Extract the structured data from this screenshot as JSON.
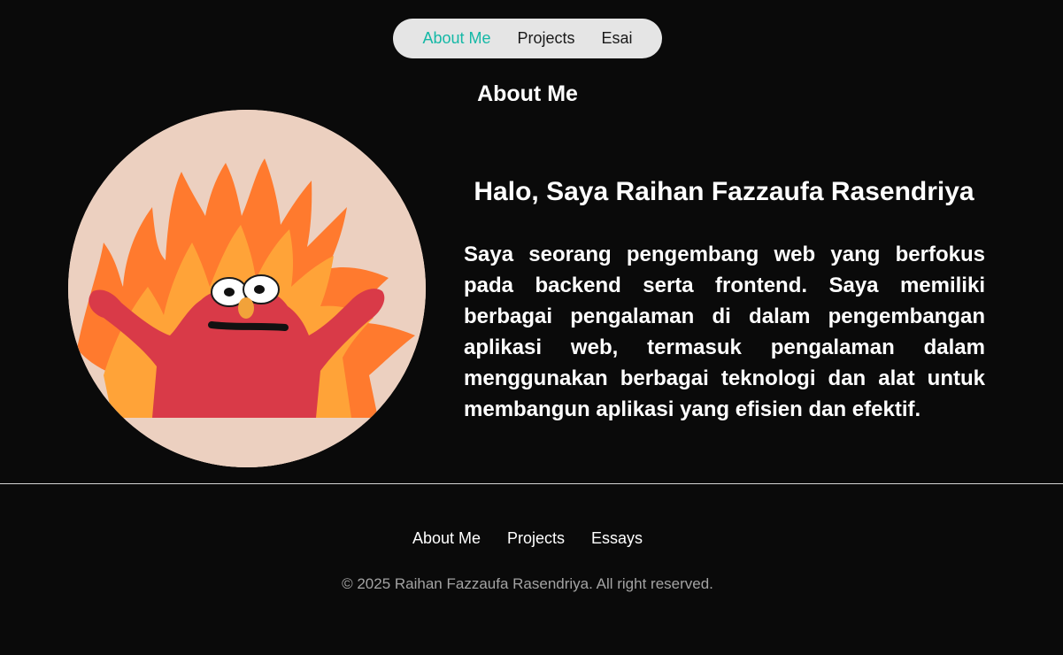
{
  "nav": {
    "items": [
      {
        "label": "About Me",
        "active": true
      },
      {
        "label": "Projects",
        "active": false
      },
      {
        "label": "Esai",
        "active": false
      }
    ]
  },
  "about": {
    "section_title": "About Me",
    "headline": "Halo, Saya Raihan Fazzaufa Rasendriya",
    "bio": "Saya seorang pengembang web yang berfokus pada backend serta frontend. Saya memiliki berbagai pengalaman di dalam pengembangan aplikasi web, termasuk pengalaman dalam menggunakan berbagai teknologi dan alat untuk membangun aplikasi yang efisien dan efektif.",
    "avatar": {
      "icon": "elmo-fire-meme-avatar"
    }
  },
  "footer": {
    "links": [
      {
        "label": "About Me"
      },
      {
        "label": "Projects"
      },
      {
        "label": "Essays"
      }
    ],
    "copyright": "© 2025 Raihan Fazzaufa Rasendriya. All right reserved."
  },
  "colors": {
    "background": "#0a0a0a",
    "nav_bg": "#e5e5e5",
    "accent": "#14b8a6",
    "muted": "#a3a3a3"
  }
}
